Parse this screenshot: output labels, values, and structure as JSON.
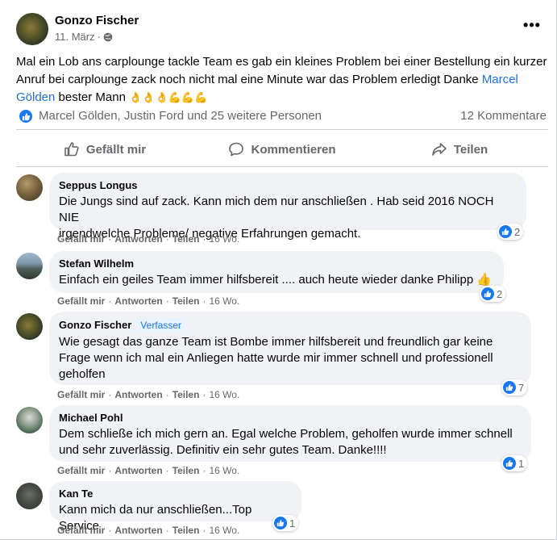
{
  "post": {
    "author": "Gonzo Fischer",
    "date": "11. März",
    "date_separator": "·",
    "text_before": "Mal ein Lob ans carplounge tackle Team  es gab ein kleines Problem  bei einer Bestellung  ein kurzer Anruf  bei carplounge  zack noch nicht mal eine Minute war das Problem erledigt  Danke ",
    "mention": "Marcel Gölden",
    "text_after": "  bester Mann ",
    "emojis": "👌👌👌💪💪💪"
  },
  "reactions": {
    "summary": "Marcel Gölden, Justin Ford und 25 weitere Personen",
    "comments": "12 Kommentare"
  },
  "actions": {
    "like": "Gefällt mir",
    "comment": "Kommentieren",
    "share": "Teilen"
  },
  "comment_actions": {
    "like": "Gefällt mir",
    "reply": "Antworten",
    "share": "Teilen",
    "sep": "·"
  },
  "comments": [
    {
      "name": "Seppus Longus",
      "text_lines": [
        "Die Jungs sind auf zack. Kann mich dem nur anschließen . Hab seid 2016 NOCH NIE",
        "irgendwelche Probleme/ negative Erfahrungen gemacht."
      ],
      "time": "16 Wo.",
      "likes": "2"
    },
    {
      "name": "Stefan Wilhelm",
      "text_lines": [
        "Einfach ein geiles Team immer hilfsbereit .... auch heute wieder danke Philipp 👍"
      ],
      "time": "16 Wo.",
      "likes": "2"
    },
    {
      "name": "Gonzo Fischer",
      "badge": "Verfasser",
      "text_lines": [
        "Wie gesagt das ganze Team ist Bombe immer hilfsbereit und freundlich gar keine",
        "Frage wenn ich mal ein Anliegen hatte wurde mir immer schnell und professionell",
        "geholfen"
      ],
      "time": "16 Wo.",
      "likes": "7"
    },
    {
      "name": "Michael Pohl",
      "text_lines": [
        "Dem schließe ich mich gern an. Egal welche Problem, geholfen wurde immer schnell",
        "und sehr zuverlässig. Definitiv ein sehr gutes Team. Danke!!!!"
      ],
      "time": "16 Wo.",
      "likes": "1"
    },
    {
      "name": "Kan Te",
      "text_lines": [
        "Kann mich da nur anschließen...Top Service"
      ],
      "time": "16 Wo.",
      "likes": "1"
    }
  ],
  "colors": {
    "link": "#216fdb",
    "like_blue": "#1877f2",
    "bubble": "#f0f2f5",
    "secondary_text": "#65676b"
  }
}
